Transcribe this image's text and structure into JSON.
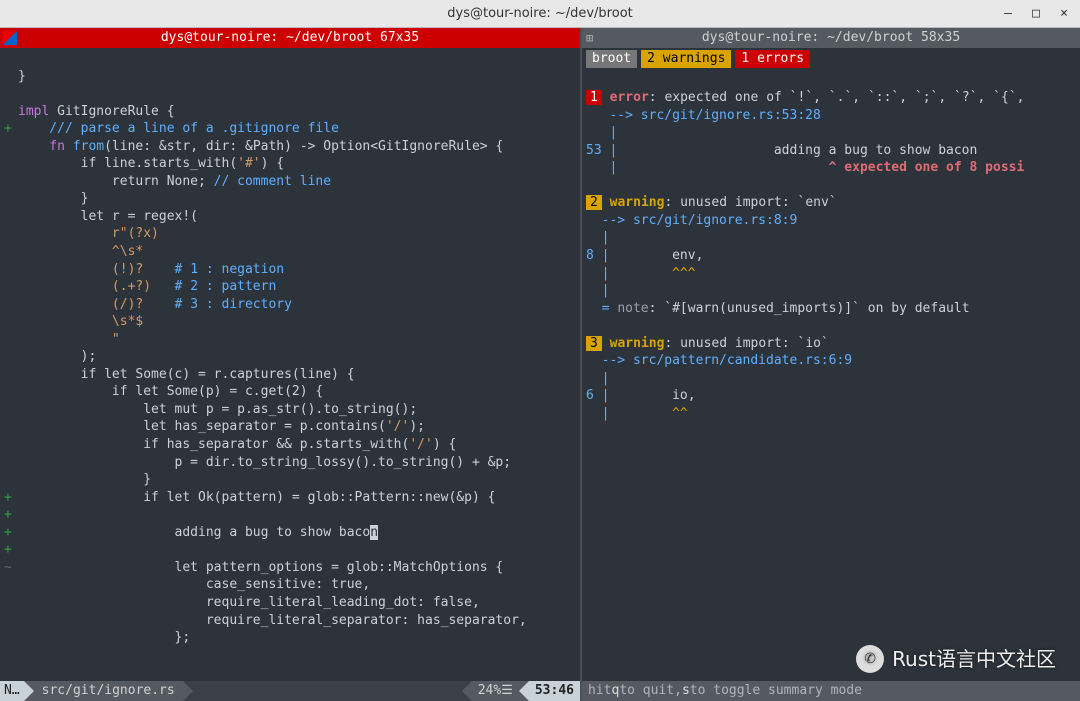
{
  "window": {
    "title": "dys@tour-noire: ~/dev/broot",
    "btn_min": "—",
    "btn_max": "□",
    "btn_close": "×"
  },
  "left": {
    "title": "dys@tour-noire: ~/dev/broot 67x35",
    "code": {
      "l01": "}",
      "l02": "",
      "l03a": "impl",
      "l03b": " GitIgnoreRule {",
      "l04": "    /// parse a line of a .gitignore file",
      "l05a": "    fn ",
      "l05b": "from",
      "l05c": "(line: &str, dir: &Path) -> Option<GitIgnoreRule> {",
      "l06a": "        if line.starts_with(",
      "l06b": "'#'",
      "l06c": ") {",
      "l07a": "            return None; ",
      "l07b": "// comment line",
      "l08": "        }",
      "l09": "        let r = regex!(",
      "l10": "            r\"(?x)",
      "l11": "            ^\\s*",
      "l12a": "            (!)?",
      "l12b": "    # 1 : negation",
      "l13a": "            (.+?)",
      "l13b": "   # 2 : pattern",
      "l14a": "            (/)?",
      "l14b": "    # 3 : directory",
      "l15": "            \\s*$",
      "l16": "            \"",
      "l17": "        );",
      "l18": "        if let Some(c) = r.captures(line) {",
      "l19": "            if let Some(p) = c.get(2) {",
      "l20": "                let mut p = p.as_str().to_string();",
      "l21a": "                let has_separator = p.contains(",
      "l21b": "'/'",
      "l21c": ");",
      "l22a": "                if has_separator && p.starts_with(",
      "l22b": "'/'",
      "l22c": ") {",
      "l23": "                    p = dir.to_string_lossy().to_string() + &p;",
      "l24": "                }",
      "l25": "                if let Ok(pattern) = glob::Pattern::new(&p) {",
      "l26": "",
      "l27a": "                    adding a bug to show baco",
      "l27b": "n",
      "l28": "",
      "l29": "                    let pattern_options = glob::MatchOptions {",
      "l30": "                        case_sensitive: true,",
      "l31": "                        require_literal_leading_dot: false,",
      "l32": "                        require_literal_separator: has_separator,",
      "l33": "                    };"
    },
    "status": {
      "mode": "N…",
      "path": "src/git/ignore.rs",
      "percent": "24%",
      "bars": "☰",
      "pos": "53:46"
    }
  },
  "right": {
    "title": "dys@tour-noire: ~/dev/broot 58x35",
    "badges": {
      "project": "broot",
      "warns": "2 warnings",
      "errs": "1 errors"
    },
    "d1": {
      "num": "1",
      "head_a": "error",
      "head_b": ": expected one of `!`, `.`, `::`, `;`, `?`, `{`,",
      "loc": "   --> src/git/ignore.rs:53:28",
      "ln": "53",
      "code": "                    adding a bug to show bacon",
      "caret": "                           ^ expected one of 8 possi"
    },
    "d2": {
      "num": "2",
      "head_a": "warning",
      "head_b": ": unused import: `env`",
      "loc": "  --> src/git/ignore.rs:8:9",
      "ln": "8",
      "code": "        env,",
      "caret": "        ^^^",
      "note_a": "note",
      "note_b": ": `#[warn(unused_imports)]` on by default"
    },
    "d3": {
      "num": "3",
      "head_a": "warning",
      "head_b": ": unused import: `io`",
      "loc": "  --> src/pattern/candidate.rs:6:9",
      "ln": "6",
      "code": "        io,",
      "caret": "        ^^"
    },
    "hint_a": "hit ",
    "hint_q": "q",
    "hint_b": " to quit, ",
    "hint_s": "s",
    "hint_c": " to toggle summary mode"
  },
  "watermark": "Rust语言中文社区"
}
